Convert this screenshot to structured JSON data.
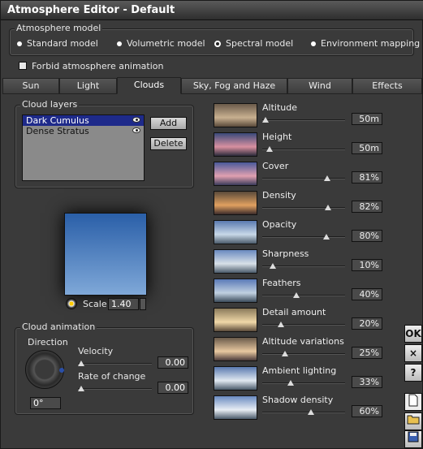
{
  "window": {
    "title": "Atmosphere Editor - Default"
  },
  "atmosphere_model": {
    "legend": "Atmosphere model",
    "options": [
      "Standard model",
      "Volumetric model",
      "Spectral model",
      "Environment mapping"
    ],
    "selected": "Spectral model"
  },
  "forbid_animation": {
    "label": "Forbid atmosphere animation",
    "checked": false
  },
  "tabs": [
    "Sun",
    "Light",
    "Clouds",
    "Sky, Fog and Haze",
    "Wind",
    "Effects"
  ],
  "active_tab": "Clouds",
  "cloud_layers": {
    "legend": "Cloud layers",
    "items": [
      "Dark Cumulus",
      "Dense Stratus"
    ],
    "selected": "Dark Cumulus",
    "add_label": "Add",
    "delete_label": "Delete"
  },
  "preview": {
    "scale_label": "Scale",
    "scale_value": "1.40"
  },
  "cloud_animation": {
    "legend": "Cloud animation",
    "direction_label": "Direction",
    "direction_value": "0°",
    "velocity_label": "Velocity",
    "velocity_value": "0.00",
    "rate_label": "Rate of change",
    "rate_value": "0.00"
  },
  "params": [
    {
      "label": "Altitude",
      "value": "50m",
      "level": 0.0
    },
    {
      "label": "Height",
      "value": "50m",
      "level": 0.05
    },
    {
      "label": "Cover",
      "value": "81%",
      "level": 0.81
    },
    {
      "label": "Density",
      "value": "82%",
      "level": 0.82
    },
    {
      "label": "Opacity",
      "value": "80%",
      "level": 0.8
    },
    {
      "label": "Sharpness",
      "value": "10%",
      "level": 0.1
    },
    {
      "label": "Feathers",
      "value": "40%",
      "level": 0.4
    },
    {
      "label": "Detail amount",
      "value": "20%",
      "level": 0.2
    },
    {
      "label": "Altitude variations",
      "value": "25%",
      "level": 0.25
    },
    {
      "label": "Ambient lighting",
      "value": "33%",
      "level": 0.33
    },
    {
      "label": "Shadow density",
      "value": "60%",
      "level": 0.6
    }
  ],
  "side_buttons": {
    "ok": "OK",
    "cancel": "×",
    "help": "?"
  },
  "colors": {
    "selection": "#1e2a8a",
    "window_bg": "#3a3a3a",
    "sky_top": "#2a5fa8",
    "sky_bottom": "#7fa8d8"
  }
}
